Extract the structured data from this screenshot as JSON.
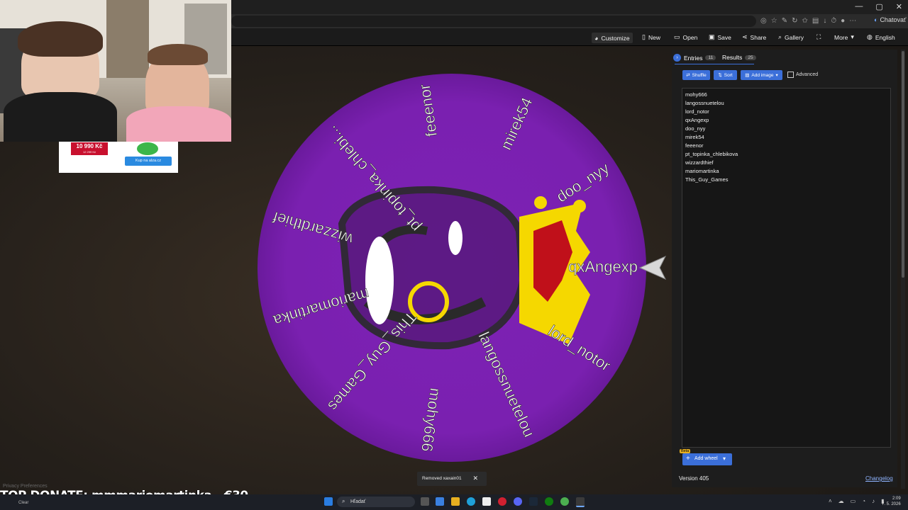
{
  "browser": {
    "chat_label": "Chatovať"
  },
  "nav": {
    "customize": "Customize",
    "new": "New",
    "open": "Open",
    "save": "Save",
    "share": "Share",
    "gallery": "Gallery",
    "more": "More",
    "language": "English"
  },
  "ad": {
    "price": "10 990 Kč",
    "old_price": "12 299 Kč",
    "button": "Kup na alza.cz"
  },
  "wheel": {
    "entries": [
      "mohy666",
      "langossnuetelou",
      "lord_notor",
      "qxAngexp",
      "doo_nyy",
      "mirek54",
      "feeenor",
      "pt_topinka_chlebikova",
      "wizzardthief",
      "mariomartinka",
      "This_Guy_Games"
    ],
    "wheel_labels": [
      "qxAngexp",
      "doo_nyy",
      "mirek54",
      "feeenor",
      "pt_topinka_chlebi...",
      "wizzardthief",
      "mariomartinka",
      "This_Guy_Games",
      "mohy666",
      "langossnuetelou",
      "lord_notor"
    ],
    "colors": {
      "wheel": "#7b21b0",
      "crown": "#f5d800",
      "crown_red": "#c0101a"
    }
  },
  "panel": {
    "tab_entries": "Entries",
    "entries_count": "11",
    "tab_results": "Results",
    "results_count": "25",
    "shuffle": "Shuffle",
    "sort": "Sort",
    "add_image": "Add image",
    "advanced": "Advanced",
    "add_wheel": "Add wheel",
    "beta": "Beta",
    "version": "Version 405",
    "changelog": "Changelog"
  },
  "toast": {
    "message": "Removed xaxain01"
  },
  "overlay": {
    "donate": "TOP DONATE: mmmariomartinka - €30",
    "privacy": "Privacy Preferences"
  },
  "taskbar": {
    "search": "Hľadať",
    "time": "2:09",
    "date": "7. 5. 2026",
    "weather": "Clear"
  }
}
